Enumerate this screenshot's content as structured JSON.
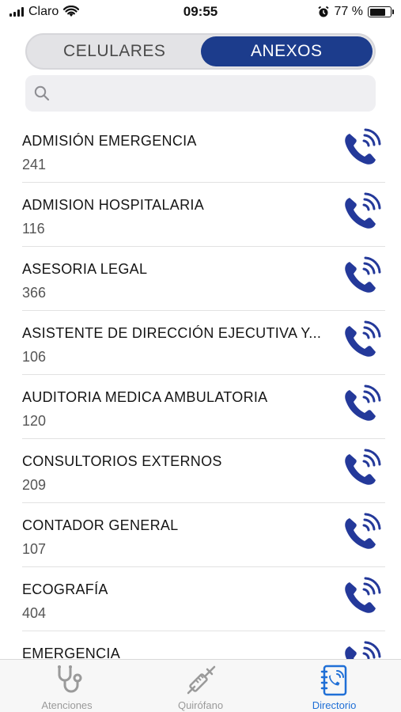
{
  "status_bar": {
    "carrier": "Claro",
    "time": "09:55",
    "battery_percent": "77 %",
    "battery_level": 0.77
  },
  "segmented": {
    "options": [
      "CELULARES",
      "ANEXOS"
    ],
    "selected": "ANEXOS"
  },
  "search": {
    "placeholder": "",
    "value": ""
  },
  "contacts": [
    {
      "name": "ADMISIÓN EMERGENCIA",
      "ext": "241"
    },
    {
      "name": "ADMISION HOSPITALARIA",
      "ext": "116"
    },
    {
      "name": "ASESORIA LEGAL",
      "ext": "366"
    },
    {
      "name": "ASISTENTE DE DIRECCIÓN EJECUTIVA Y...",
      "ext": "106"
    },
    {
      "name": "AUDITORIA MEDICA AMBULATORIA",
      "ext": "120"
    },
    {
      "name": "CONSULTORIOS EXTERNOS",
      "ext": "209"
    },
    {
      "name": "CONTADOR GENERAL",
      "ext": "107"
    },
    {
      "name": "ECOGRAFÍA",
      "ext": "404"
    },
    {
      "name": "EMERGENCIA",
      "ext": ""
    }
  ],
  "tabbar": {
    "tabs": [
      {
        "label": "Atenciones",
        "icon": "stethoscope-icon"
      },
      {
        "label": "Quirófano",
        "icon": "syringe-icon"
      },
      {
        "label": "Directorio",
        "icon": "directory-phone-icon"
      }
    ],
    "active": "Directorio"
  },
  "colors": {
    "accent": "#1c3c8c",
    "active_tab": "#1f6fd6",
    "call_icon": "#24399a",
    "inactive_tab": "#9a9a9a"
  }
}
